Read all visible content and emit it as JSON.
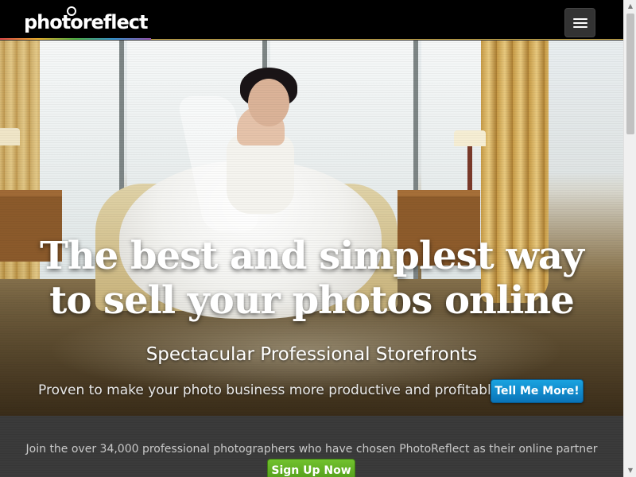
{
  "header": {
    "logo_text": "photoreflect",
    "menu_icon": "hamburger-menu-icon"
  },
  "hero": {
    "headline_line1": "The best and simplest way",
    "headline_line2": "to sell your photos online",
    "subheadline": "Spectacular Professional Storefronts",
    "tagline": "Proven to make your photo business more productive and profitable",
    "cta_label": "Tell Me More!",
    "cta_color": "#0e86cc"
  },
  "promo": {
    "text": "Join the over 34,000 professional photographers who have chosen PhotoReflect as their online partner",
    "signup_label": "Sign Up Now",
    "signup_color": "#5fb021"
  },
  "scrollbar": {
    "up_icon": "scroll-up-arrow-icon",
    "down_icon": "scroll-down-arrow-icon"
  }
}
